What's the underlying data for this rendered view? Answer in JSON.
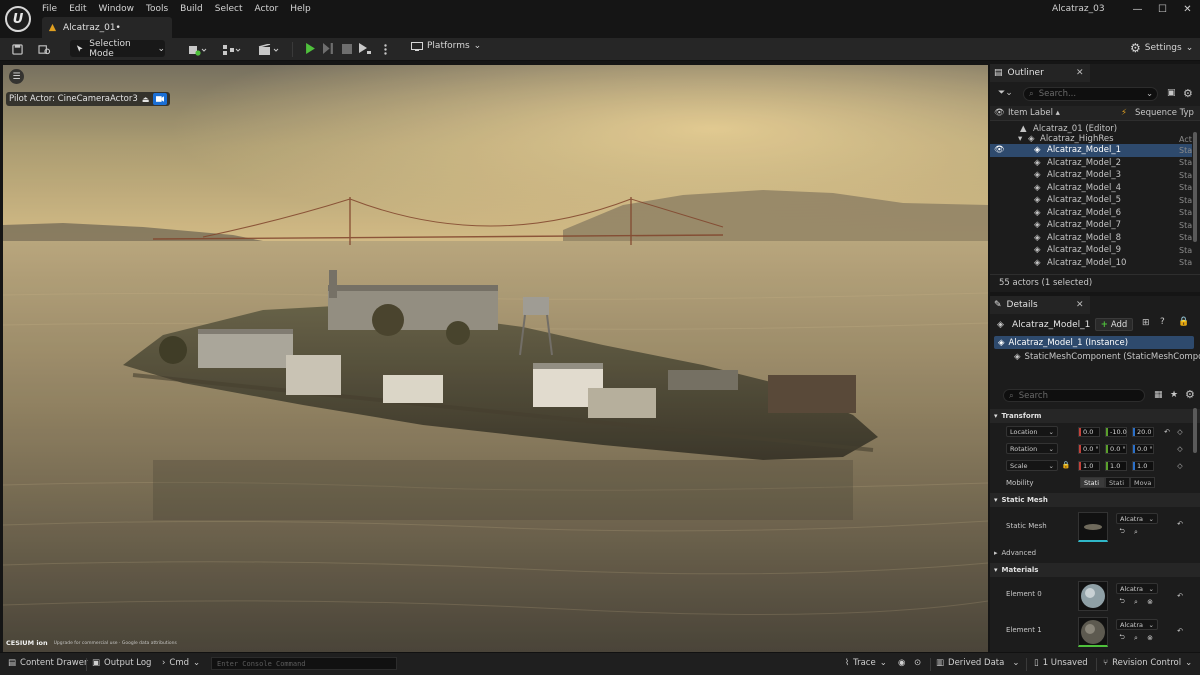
{
  "app": {
    "window_title": "Alcatraz_03",
    "menu": [
      "File",
      "Edit",
      "Window",
      "Tools",
      "Build",
      "Select",
      "Actor",
      "Help"
    ],
    "document_tab": "Alcatraz_01•"
  },
  "toolbar": {
    "selection_mode": "Selection Mode",
    "platforms": "Platforms",
    "settings": "Settings"
  },
  "viewport": {
    "pilot_actor": "Pilot Actor: CineCameraActor3",
    "cesium_logo": "CESIUM ion",
    "cesium_credit": "Upgrade for commercial use · Google data attributions"
  },
  "outliner": {
    "tab": "Outliner",
    "search_placeholder": "Search...",
    "col_label": "Item Label ▴",
    "col_type": "Sequence Typ",
    "rows": [
      {
        "label": "Alcatraz_01 (Editor)",
        "type": ""
      },
      {
        "label": "Alcatraz_HighRes",
        "type": "Act"
      },
      {
        "label": "Alcatraz_Model_1",
        "type": "Sta"
      },
      {
        "label": "Alcatraz_Model_2",
        "type": "Sta"
      },
      {
        "label": "Alcatraz_Model_3",
        "type": "Sta"
      },
      {
        "label": "Alcatraz_Model_4",
        "type": "Sta"
      },
      {
        "label": "Alcatraz_Model_5",
        "type": "Sta"
      },
      {
        "label": "Alcatraz_Model_6",
        "type": "Sta"
      },
      {
        "label": "Alcatraz_Model_7",
        "type": "Sta"
      },
      {
        "label": "Alcatraz_Model_8",
        "type": "Sta"
      },
      {
        "label": "Alcatraz_Model_9",
        "type": "Sta"
      },
      {
        "label": "Alcatraz_Model_10",
        "type": "Sta"
      }
    ],
    "actor_count": "55 actors (1 selected)"
  },
  "details": {
    "tab": "Details",
    "object_name": "Alcatraz_Model_1",
    "add_label": "Add",
    "component_root": "Alcatraz_Model_1 (Instance)",
    "component_child": "StaticMeshComponent (StaticMeshComponent)",
    "search_placeholder": "Search",
    "sections": {
      "transform": "Transform",
      "static_mesh": "Static Mesh",
      "advanced": "Advanced",
      "materials": "Materials"
    },
    "transform": {
      "location_label": "Location",
      "rotation_label": "Rotation",
      "scale_label": "Scale",
      "location": [
        "0.0",
        "-10.0",
        "20.0"
      ],
      "rotation": [
        "0.0 °",
        "0.0 °",
        "0.0 °"
      ],
      "scale": [
        "1.0",
        "1.0",
        "1.0"
      ]
    },
    "mobility": {
      "label": "Mobility",
      "options": [
        "Static",
        "Stationary",
        "Movable"
      ],
      "options_shown": [
        "Stati",
        "Stati",
        "Mova"
      ]
    },
    "static_mesh_label": "Static Mesh",
    "static_mesh_value": "Alcatra",
    "materials": [
      {
        "label": "Element 0",
        "value": "Alcatra"
      },
      {
        "label": "Element 1",
        "value": "Alcatra"
      }
    ]
  },
  "statusbar": {
    "content_drawer": "Content Drawer",
    "output_log": "Output Log",
    "cmd": "Cmd",
    "console_placeholder": "Enter Console Command",
    "trace": "Trace",
    "derived_data": "Derived Data",
    "unsaved": "1 Unsaved",
    "revision_control": "Revision Control"
  },
  "colors": {
    "accent_blue": "#1a6fd6",
    "selection": "#2e4a6d",
    "play_green": "#4fc13c",
    "panel_bg": "#1c1c1c"
  }
}
